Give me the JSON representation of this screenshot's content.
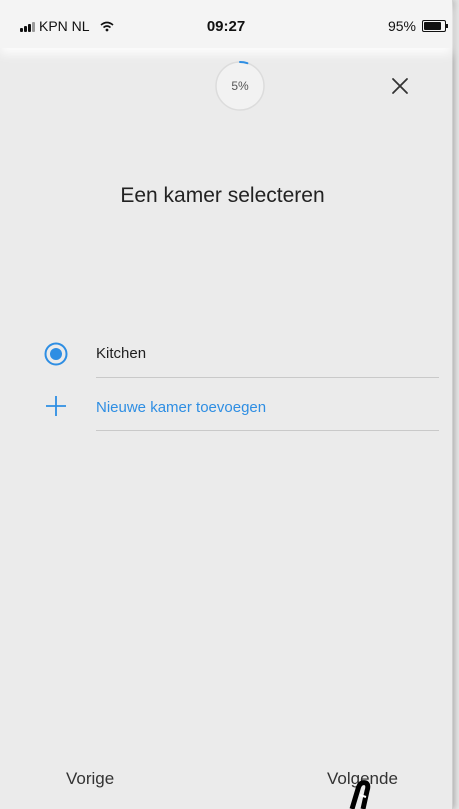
{
  "status_bar": {
    "carrier": "KPN NL",
    "time": "09:27",
    "battery": "95%",
    "battery_level": 0.95
  },
  "header": {
    "progress_label": "5%",
    "progress_value": 0.05,
    "close_icon": "close-icon"
  },
  "main": {
    "title": "Een kamer selecteren",
    "rooms": [
      {
        "label": "Kitchen",
        "selected": true
      }
    ],
    "add_room_label": "Nieuwe kamer toevoegen"
  },
  "footer": {
    "prev_label": "Vorige",
    "next_label": "Volgende"
  },
  "colors": {
    "accent": "#2e8ee3",
    "background": "#ebebeb"
  }
}
